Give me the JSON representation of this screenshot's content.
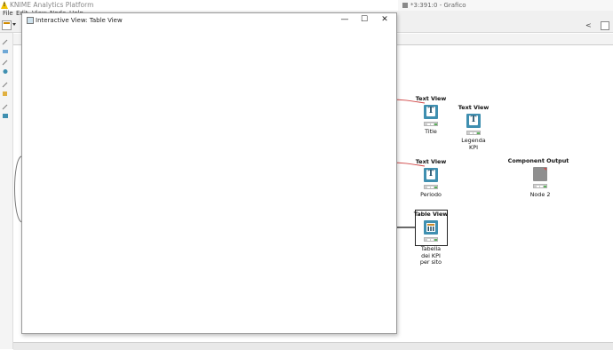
{
  "app": {
    "title": "KNIME Analytics Platform",
    "brand_color": "#f2c200"
  },
  "menu": [
    {
      "label": "File"
    },
    {
      "label": "Edit"
    },
    {
      "label": "View"
    },
    {
      "label": "Node"
    },
    {
      "label": "Help"
    }
  ],
  "editor_tab": {
    "label": "*3:391:0 - Grafico"
  },
  "nodes": {
    "text_view_title": {
      "header": "Text View",
      "label": "Title",
      "glyph": "T"
    },
    "text_view_legenda": {
      "header": "Text View",
      "label": "Legenda\nKPI",
      "glyph": "T"
    },
    "text_view_periodo": {
      "header": "Text View",
      "label": "Periodo",
      "glyph": "T"
    },
    "component_output": {
      "header": "Component Output",
      "label": "Node 2"
    },
    "table_view": {
      "header": "Table View",
      "label": "Tabella\ndei KPI\nper sito"
    }
  },
  "dialog": {
    "title": "Interactive View: Table View",
    "minimize": "—",
    "maximize": "☐",
    "close": "✕"
  },
  "colors": {
    "node_blue": "#3f8fb0",
    "connection_red": "#d04848",
    "status_green": "#5db35d"
  }
}
